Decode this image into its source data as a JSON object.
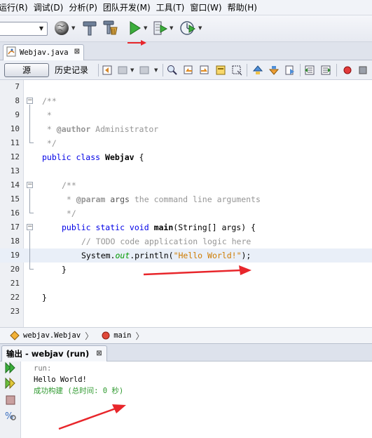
{
  "menu": {
    "items": [
      "运行(R)",
      "调试(D)",
      "分析(P)",
      "团队开发(M)",
      "工具(T)",
      "窗口(W)",
      "帮助(H)"
    ]
  },
  "toolbar": {
    "config_value": "",
    "icons": [
      "globe-icon",
      "hammer-icon",
      "clean-build-icon",
      "run-icon",
      "debug-icon",
      "profile-icon"
    ]
  },
  "editor_tab": {
    "filename": "Webjav.java",
    "close": "⊠"
  },
  "editor_toolbar": {
    "source_label": "源",
    "history_label": "历史记录"
  },
  "code": {
    "lines": [
      {
        "n": "7"
      },
      {
        "n": "8"
      },
      {
        "n": "9"
      },
      {
        "n": "10"
      },
      {
        "n": "11"
      },
      {
        "n": "12"
      },
      {
        "n": "13"
      },
      {
        "n": "14"
      },
      {
        "n": "15"
      },
      {
        "n": "16"
      },
      {
        "n": "17"
      },
      {
        "n": "18"
      },
      {
        "n": "19"
      },
      {
        "n": "20"
      },
      {
        "n": "21"
      },
      {
        "n": "22"
      },
      {
        "n": "23"
      }
    ],
    "t": {
      "l8": "/**",
      "l9": " *",
      "l10_tag": "@author",
      "l10_rest": " Administrator",
      "l11": " */",
      "l12_kw": "public class ",
      "l12_cls": "Webjav",
      "l12_rest": " {",
      "l14": "/**",
      "l15_star": " * ",
      "l15_tag": "@param",
      "l15_arg": " args",
      "l15_rest": " the command line arguments",
      "l16": " */",
      "l17_kw": "public static void ",
      "l17_m": "main",
      "l17_rest": "(String[] args) {",
      "l18": "// TODO code application logic here",
      "l19_a": "System.",
      "l19_out": "out",
      "l19_b": ".println(",
      "l19_str": "\"Hello World!\"",
      "l19_c": ");",
      "l20": "}",
      "l22": "}"
    }
  },
  "breadcrumb": {
    "items": [
      "webjav.Webjav",
      "main"
    ]
  },
  "output": {
    "tab_label": "输出 - webjav (run)",
    "close": "⊠",
    "lines": [
      "run:",
      "Hello World!",
      "成功构建 (总时间: 0 秒)"
    ]
  },
  "colors": {
    "keyword": "#0000e6",
    "comment": "#969696",
    "string": "#ce7b00",
    "field": "#009900",
    "build_success": "#2f9a2f",
    "annotation_arrow": "#e8262b"
  }
}
